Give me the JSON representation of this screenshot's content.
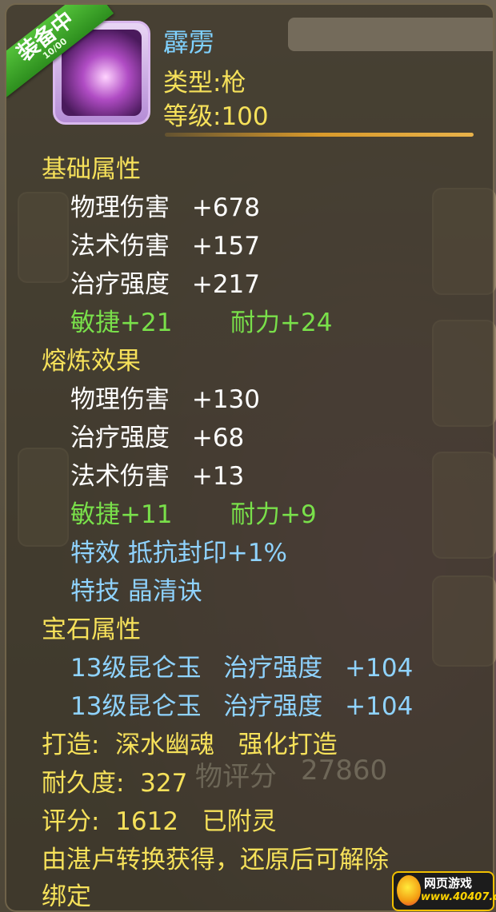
{
  "item": {
    "status_ribbon": "装备中",
    "ribbon_sub": "10/00",
    "name": "霹雳",
    "type_line": "类型:枪",
    "level_line": "等级:100"
  },
  "base_attributes": {
    "title": "基础属性",
    "rows": [
      {
        "label": "物理伤害",
        "value": "+678"
      },
      {
        "label": "法术伤害",
        "value": "+157"
      },
      {
        "label": "治疗强度",
        "value": "+217"
      }
    ],
    "extra_left": "敏捷+21",
    "extra_right": "耐力+24"
  },
  "refine_effects": {
    "title": "熔炼效果",
    "rows": [
      {
        "label": "物理伤害",
        "value": "+130"
      },
      {
        "label": "治疗强度",
        "value": "+68"
      },
      {
        "label": "法术伤害",
        "value": "+13"
      }
    ],
    "extra_left": "敏捷+11",
    "extra_right": "耐力+9",
    "special_effect": "特效  抵抗封印+1%",
    "special_skill": "特技  晶清诀"
  },
  "gem_attributes": {
    "title": "宝石属性",
    "rows": [
      {
        "gem": "13级昆仑玉",
        "attr": "治疗强度",
        "value": "+104"
      },
      {
        "gem": "13级昆仑玉",
        "attr": "治疗强度",
        "value": "+104"
      }
    ]
  },
  "footer": {
    "forge": "打造:  深水幽魂   强化打造",
    "durability": "耐久度:  327",
    "score": "评分:  1612   已附灵",
    "note_line1": "由湛卢转换获得，还原后可解除",
    "note_line2": "绑定"
  },
  "background": {
    "faded_score_label": "物评分",
    "faded_score_value": "27860"
  },
  "watermark": {
    "top": "网页游戏",
    "bottom": "www.40407.com"
  },
  "colors": {
    "section": "#f6e15a",
    "green_attr": "#79e04a",
    "blue_attr": "#8fd3ff",
    "name": "#7fd1ff"
  }
}
